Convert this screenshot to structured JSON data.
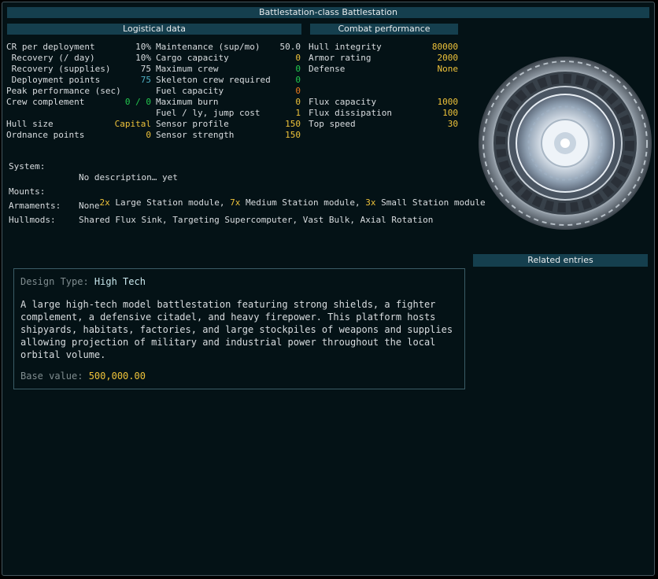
{
  "title": "Battlestation-class Battlestation",
  "logistics": {
    "header": "Logistical data",
    "col1": [
      {
        "label": "CR per deployment",
        "value": "10%",
        "color": "w"
      },
      {
        "label": " Recovery (/ day)",
        "value": "10%",
        "color": "w"
      },
      {
        "label": " Recovery (supplies)",
        "value": "75",
        "color": "w"
      },
      {
        "label": " Deployment points",
        "value": "75",
        "color": "c"
      },
      {
        "label": "Peak performance (sec)",
        "value": "",
        "color": "w"
      },
      {
        "label": "Crew complement",
        "value": "0 / 0",
        "color": "g"
      },
      {
        "label": "",
        "value": "",
        "color": "w"
      },
      {
        "label": "Hull size",
        "value": "Capital",
        "color": "y"
      },
      {
        "label": "Ordnance points",
        "value": "0",
        "color": "y"
      }
    ],
    "col2": [
      {
        "label": "Maintenance (sup/mo)",
        "value": "50.0",
        "color": "w"
      },
      {
        "label": "Cargo capacity",
        "value": "0",
        "color": "y"
      },
      {
        "label": "Maximum crew",
        "value": "0",
        "color": "g"
      },
      {
        "label": "Skeleton crew required",
        "value": "0",
        "color": "g"
      },
      {
        "label": "Fuel capacity",
        "value": "0",
        "color": "o"
      },
      {
        "label": "Maximum burn",
        "value": "0",
        "color": "y"
      },
      {
        "label": "Fuel / ly, jump cost",
        "value": "1",
        "color": "y"
      },
      {
        "label": "Sensor profile",
        "value": "150",
        "color": "y"
      },
      {
        "label": "Sensor strength",
        "value": "150",
        "color": "y"
      }
    ]
  },
  "combat": {
    "header": "Combat performance",
    "rows": [
      {
        "label": "Hull integrity",
        "value": "80000",
        "color": "y"
      },
      {
        "label": "Armor rating",
        "value": "2000",
        "color": "y"
      },
      {
        "label": "Defense",
        "value": "None",
        "color": "y"
      },
      {
        "label": "",
        "value": "",
        "color": "w"
      },
      {
        "label": "",
        "value": "",
        "color": "w"
      },
      {
        "label": "Flux capacity",
        "value": "1000",
        "color": "y"
      },
      {
        "label": "Flux dissipation",
        "value": "100",
        "color": "y"
      },
      {
        "label": "Top speed",
        "value": "30",
        "color": "y"
      }
    ]
  },
  "system": {
    "label": "System:",
    "value": "No description… yet"
  },
  "mounts": {
    "label": "Mounts:",
    "items": [
      {
        "count": "2x",
        "name": " Large Station module, "
      },
      {
        "count": "7x",
        "name": " Medium Station module, "
      },
      {
        "count": "3x",
        "name": " Small Station module"
      }
    ]
  },
  "armaments": {
    "label": "Armaments:",
    "value": "None"
  },
  "hullmods": {
    "label": "Hullmods:",
    "value": "Shared Flux Sink, Targeting Supercomputer, Vast Bulk, Axial Rotation"
  },
  "related": {
    "header": "Related entries"
  },
  "description": {
    "design_label": "Design Type: ",
    "design_value": "High Tech",
    "lines": [
      "A large high-tech model battlestation featuring strong shields, a fighter",
      "complement, a defensive citadel, and heavy firepower. This platform hosts",
      "shipyards, habitats, factories, and large stockpiles of weapons and supplies",
      "allowing projection of military and industrial power throughout the local",
      "orbital volume."
    ],
    "base_label": "Base value: ",
    "base_value": "500,000.00"
  },
  "colors": {
    "yellow": "#eec23a",
    "green": "#23c84f",
    "orange": "#ee7a1c",
    "cyan": "#4fb0c4",
    "header_bg": "#153f4e"
  }
}
